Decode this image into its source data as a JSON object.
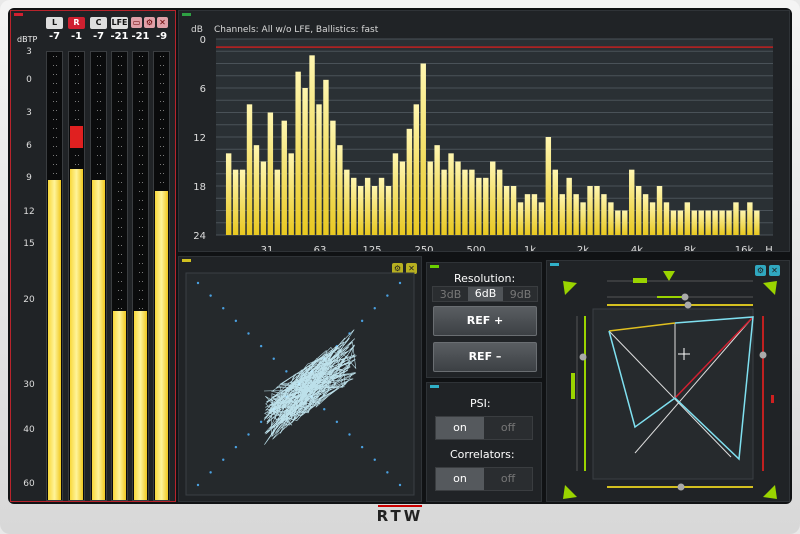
{
  "meters": {
    "unit": "dBTP",
    "channels": [
      {
        "label": "L",
        "peak": "-7",
        "level_db": 9,
        "active": false
      },
      {
        "label": "R",
        "peak": "-1",
        "level_db": 8,
        "active": true
      },
      {
        "label": "C",
        "peak": "-7",
        "level_db": 9,
        "active": false
      },
      {
        "label": "LFE",
        "peak": "-21",
        "level_db": 21,
        "active": false
      },
      {
        "label": "",
        "peak": "-21",
        "level_db": 21,
        "active": false
      },
      {
        "label": "",
        "peak": "-9",
        "level_db": 10,
        "active": false
      }
    ],
    "red_zone_db": [
      4,
      6
    ],
    "scale": [
      "0",
      "3",
      "6",
      "9",
      "12",
      "15",
      "20",
      "30",
      "40",
      "60"
    ],
    "top_scale": "3",
    "header_icons": [
      "window-icon",
      "gear-icon",
      "close-icon"
    ]
  },
  "spectrum": {
    "title": "Channels: All w/o LFE, Ballistics: fast",
    "y_unit": "dB",
    "y_ticks": [
      "0",
      "6",
      "12",
      "18",
      "24"
    ],
    "x_ticks": [
      "31",
      "63",
      "125",
      "250",
      "500",
      "1k",
      "2k",
      "4k",
      "8k",
      "16k",
      "H"
    ],
    "ref_line_db": 1,
    "chart_data": {
      "type": "bar",
      "ylim": [
        0,
        24
      ],
      "y_inverted": true,
      "values": [
        24,
        14,
        16,
        16,
        8,
        13,
        15,
        9,
        16,
        10,
        14,
        4,
        6,
        2,
        8,
        5,
        10,
        13,
        16,
        17,
        18,
        17,
        18,
        17,
        18,
        14,
        15,
        11,
        8,
        3,
        15,
        13,
        16,
        14,
        15,
        16,
        16,
        17,
        17,
        15,
        16,
        18,
        18,
        20,
        19,
        19,
        20,
        12,
        16,
        19,
        17,
        19,
        20,
        18,
        18,
        19,
        20,
        21,
        21,
        16,
        18,
        19,
        20,
        18,
        20,
        21,
        21,
        20,
        21,
        21,
        21,
        21,
        21,
        21,
        20,
        21,
        20,
        21,
        24
      ]
    }
  },
  "vector": {
    "icons": [
      "gear-icon",
      "close-icon"
    ]
  },
  "controls": {
    "resolution_label": "Resolution:",
    "resolution_options": [
      "3dB",
      "6dB",
      "9dB"
    ],
    "resolution_selected": "6dB",
    "ref_plus": "REF +",
    "ref_minus": "REF –",
    "psi_label": "PSI:",
    "psi_on": "on",
    "psi_off": "off",
    "correlators_label": "Correlators:",
    "corr_on": "on",
    "corr_off": "off",
    "accent": "#9ad400"
  },
  "surround": {
    "icons": [
      "gear-icon",
      "close-icon"
    ]
  },
  "brand": "RTW"
}
